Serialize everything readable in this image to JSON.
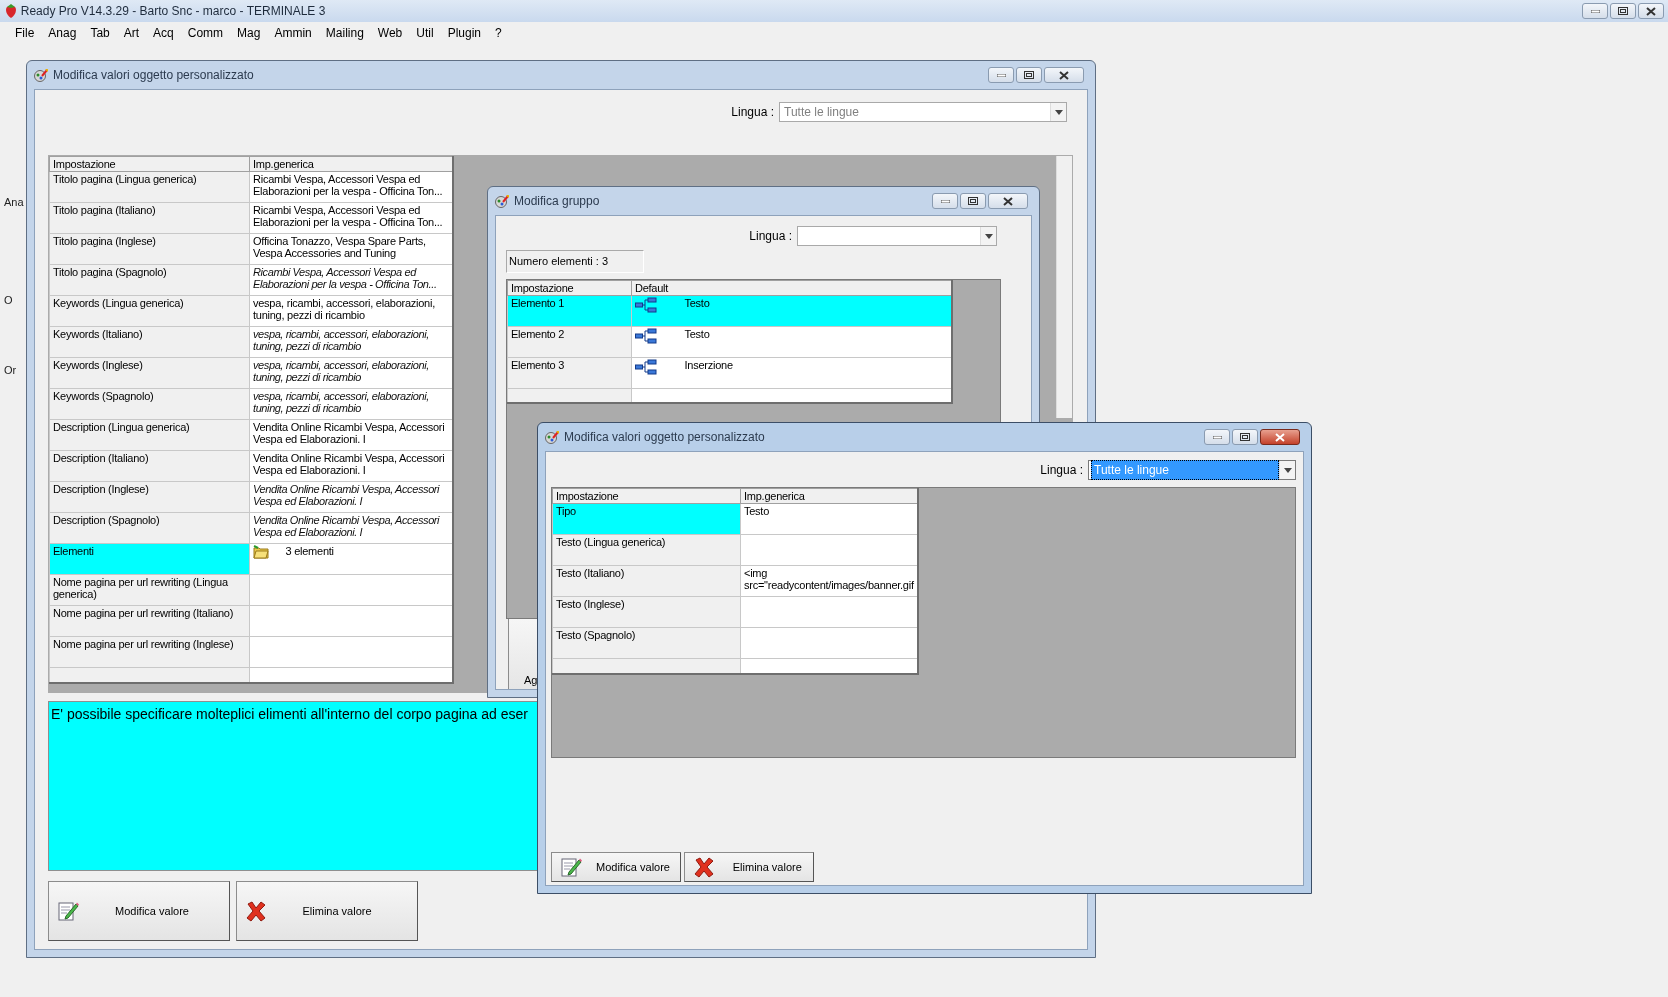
{
  "app": {
    "title": "Ready Pro V14.3.29 - Barto Snc - marco - TERMINALE 3",
    "menu": [
      "File",
      "Anag",
      "Tab",
      "Art",
      "Acq",
      "Comm",
      "Mag",
      "Ammin",
      "Mailing",
      "Web",
      "Util",
      "Plugin",
      "?"
    ],
    "background_labels": [
      "Ana",
      "O",
      "Or"
    ]
  },
  "main_window": {
    "title": "Modifica valori oggetto personalizzato",
    "active": false,
    "language_label": "Lingua :",
    "language_value": "Tutte le lingue",
    "language_focused": false,
    "columns": [
      "Impostazione",
      "Imp.generica"
    ],
    "rows": [
      {
        "setting": "Titolo pagina (Lingua generica)",
        "value": "Ricambi Vespa, Accessori Vespa ed Elaborazioni per la vespa - Officina Ton...",
        "kind": "text",
        "inherited": false,
        "selected": false
      },
      {
        "setting": "Titolo pagina (Italiano)",
        "value": "Ricambi Vespa, Accessori Vespa ed Elaborazioni per la vespa - Officina Ton...",
        "kind": "text",
        "inherited": false,
        "selected": false
      },
      {
        "setting": "Titolo pagina (Inglese)",
        "value": "Officina Tonazzo, Vespa Spare Parts, Vespa Accessories and Tuning",
        "kind": "text",
        "inherited": false,
        "selected": false
      },
      {
        "setting": "Titolo pagina (Spagnolo)",
        "value": "Ricambi Vespa, Accessori Vespa ed Elaborazioni per la vespa - Officina Ton...",
        "kind": "text",
        "inherited": true,
        "selected": false
      },
      {
        "setting": "Keywords (Lingua generica)",
        "value": "vespa, ricambi, accessori, elaborazioni, tuning, pezzi di ricambio",
        "kind": "text",
        "inherited": false,
        "selected": false
      },
      {
        "setting": "Keywords (Italiano)",
        "value": "vespa, ricambi, accessori, elaborazioni, tuning, pezzi di ricambio",
        "kind": "text",
        "inherited": true,
        "selected": false
      },
      {
        "setting": "Keywords (Inglese)",
        "value": "vespa, ricambi, accessori, elaborazioni, tuning, pezzi di ricambio",
        "kind": "text",
        "inherited": true,
        "selected": false
      },
      {
        "setting": "Keywords (Spagnolo)",
        "value": "vespa, ricambi, accessori, elaborazioni, tuning, pezzi di ricambio",
        "kind": "text",
        "inherited": true,
        "selected": false
      },
      {
        "setting": "Description (Lingua generica)",
        "value": "Vendita  Online Ricambi Vespa, Accessori Vespa ed Elaborazioni. I",
        "kind": "text",
        "inherited": false,
        "selected": false
      },
      {
        "setting": "Description (Italiano)",
        "value": "Vendita  Online Ricambi Vespa, Accessori Vespa ed Elaborazioni. I",
        "kind": "text",
        "inherited": false,
        "selected": false
      },
      {
        "setting": "Description (Inglese)",
        "value": "Vendita  Online Ricambi Vespa, Accessori Vespa ed Elaborazioni. I",
        "kind": "text",
        "inherited": true,
        "selected": false
      },
      {
        "setting": "Description (Spagnolo)",
        "value": "Vendita  Online Ricambi Vespa, Accessori Vespa ed Elaborazioni. I",
        "kind": "text",
        "inherited": true,
        "selected": false
      },
      {
        "setting": "Elementi",
        "value": "3 elementi",
        "kind": "group",
        "inherited": false,
        "selected": true
      },
      {
        "setting": "Nome pagina per url rewriting (Lingua generica)",
        "kind": "text",
        "selected": false
      },
      {
        "setting": "Nome pagina per url rewriting (Italiano)",
        "kind": "text",
        "selected": false
      },
      {
        "setting": "Nome pagina per url rewriting (Inglese)",
        "kind": "text",
        "selected": false
      }
    ],
    "description": "E' possibile specificare molteplici elimenti all'interno del corpo pagina ad eser",
    "buttons": [
      {
        "label": "Modifica valore",
        "kind": "edit"
      },
      {
        "label": "Elimina valore",
        "kind": "delete"
      }
    ]
  },
  "group_window": {
    "title": "Modifica gruppo",
    "active": false,
    "language_label": "Lingua :",
    "language_focused": false,
    "count": "Numero elementi : 3",
    "columns": [
      "Impostazione",
      "Default"
    ],
    "rows": [
      {
        "setting": "Elemento 1",
        "value": "Testo",
        "selected": true
      },
      {
        "setting": "Elemento 2",
        "value": "Testo",
        "selected": false
      },
      {
        "setting": "Elemento 3",
        "value": "Inserzione",
        "selected": false
      }
    ],
    "partial_button": "Ag"
  },
  "front_window": {
    "title": "Modifica valori oggetto personalizzato",
    "active": true,
    "language_label": "Lingua :",
    "language_value": "Tutte le lingue",
    "language_focused": true,
    "columns": [
      "Impostazione",
      "Imp.generica"
    ],
    "rows": [
      {
        "setting": "Tipo",
        "value": "Testo",
        "selected": true
      },
      {
        "setting": "Testo (Lingua generica)",
        "selected": false
      },
      {
        "setting": "Testo (Italiano)",
        "value": "<img src=\"readycontent/images/banner.gif",
        "selected": false
      },
      {
        "setting": "Testo (Inglese)",
        "selected": false
      },
      {
        "setting": "Testo (Spagnolo)",
        "selected": false
      }
    ],
    "buttons": [
      {
        "label": "Modifica valore",
        "kind": "edit"
      },
      {
        "label": "Elimina valore",
        "kind": "delete"
      }
    ]
  }
}
